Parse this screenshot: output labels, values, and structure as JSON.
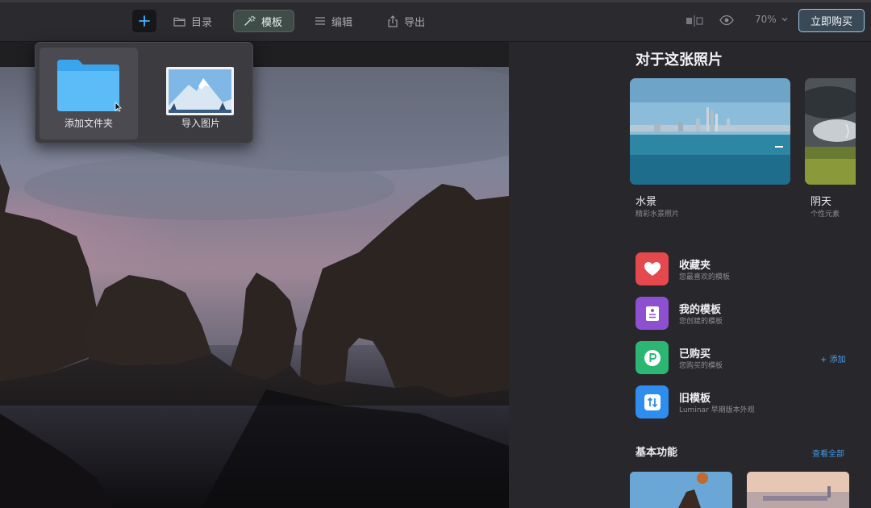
{
  "toolbar": {
    "plus_icon": "plus-icon",
    "items": [
      {
        "label": "目录",
        "icon": "folder-outline-icon"
      },
      {
        "label": "模板",
        "icon": "magic-wand-icon"
      },
      {
        "label": "编辑",
        "icon": "sliders-icon"
      },
      {
        "label": "导出",
        "icon": "share-icon"
      }
    ],
    "zoom": "70%",
    "buy_label": "立即购买"
  },
  "popup": {
    "items": [
      {
        "label": "添加文件夹",
        "icon": "folder-icon"
      },
      {
        "label": "导入图片",
        "icon": "image-icon"
      }
    ]
  },
  "panel": {
    "title": "对于这张照片",
    "cards": [
      {
        "title": "水景",
        "subtitle": "精彩水景照片"
      },
      {
        "title": "阴天",
        "subtitle": "个性元素"
      }
    ],
    "templates": [
      {
        "title": "收藏夹",
        "subtitle": "您最喜欢的模板",
        "color": "#e5484d"
      },
      {
        "title": "我的模板",
        "subtitle": "您创建的模板",
        "color": "#8e4fd1"
      },
      {
        "title": "已购买",
        "subtitle": "您购买的模板",
        "color": "#2bb673"
      },
      {
        "title": "旧模板",
        "subtitle": "Luminar 早期版本外观",
        "color": "#2f8df0"
      }
    ],
    "add_label": "+ 添加",
    "section_title": "基本功能",
    "section_link": "查看全部"
  }
}
